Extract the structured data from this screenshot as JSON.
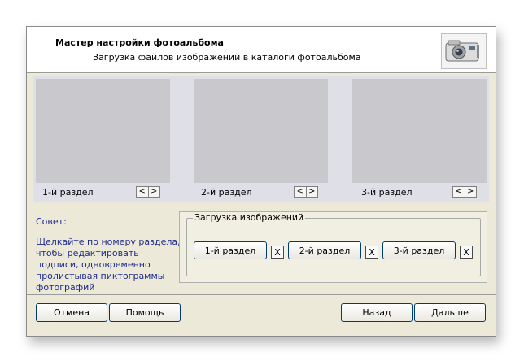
{
  "header": {
    "title": "Мастер настройки фотоальбома",
    "subtitle": "Загрузка файлов изображений в каталоги фотоальбома",
    "icon": "camera-icon"
  },
  "sections": [
    {
      "label": "1-й раздел",
      "prev": "<",
      "next": ">"
    },
    {
      "label": "2-й раздел",
      "prev": "<",
      "next": ">"
    },
    {
      "label": "3-й раздел",
      "prev": "<",
      "next": ">"
    }
  ],
  "hint": {
    "title": "Совет:",
    "text": "Щелкайте по номеру раздела, чтобы редактировать подписи, одновременно пролистывая пиктограммы фотографий"
  },
  "upload": {
    "legend": "Загрузка изображений",
    "buttons": [
      {
        "label": "1-й раздел",
        "close": "X"
      },
      {
        "label": "2-й раздел",
        "close": "X"
      },
      {
        "label": "3-й раздел",
        "close": "X"
      }
    ]
  },
  "footer": {
    "cancel": "Отмена",
    "help": "Помощь",
    "back": "Назад",
    "next": "Дальше"
  },
  "colors": {
    "panel": "#c8c8cd",
    "hint_text": "#1f2b8c",
    "button_border": "#003c74"
  }
}
